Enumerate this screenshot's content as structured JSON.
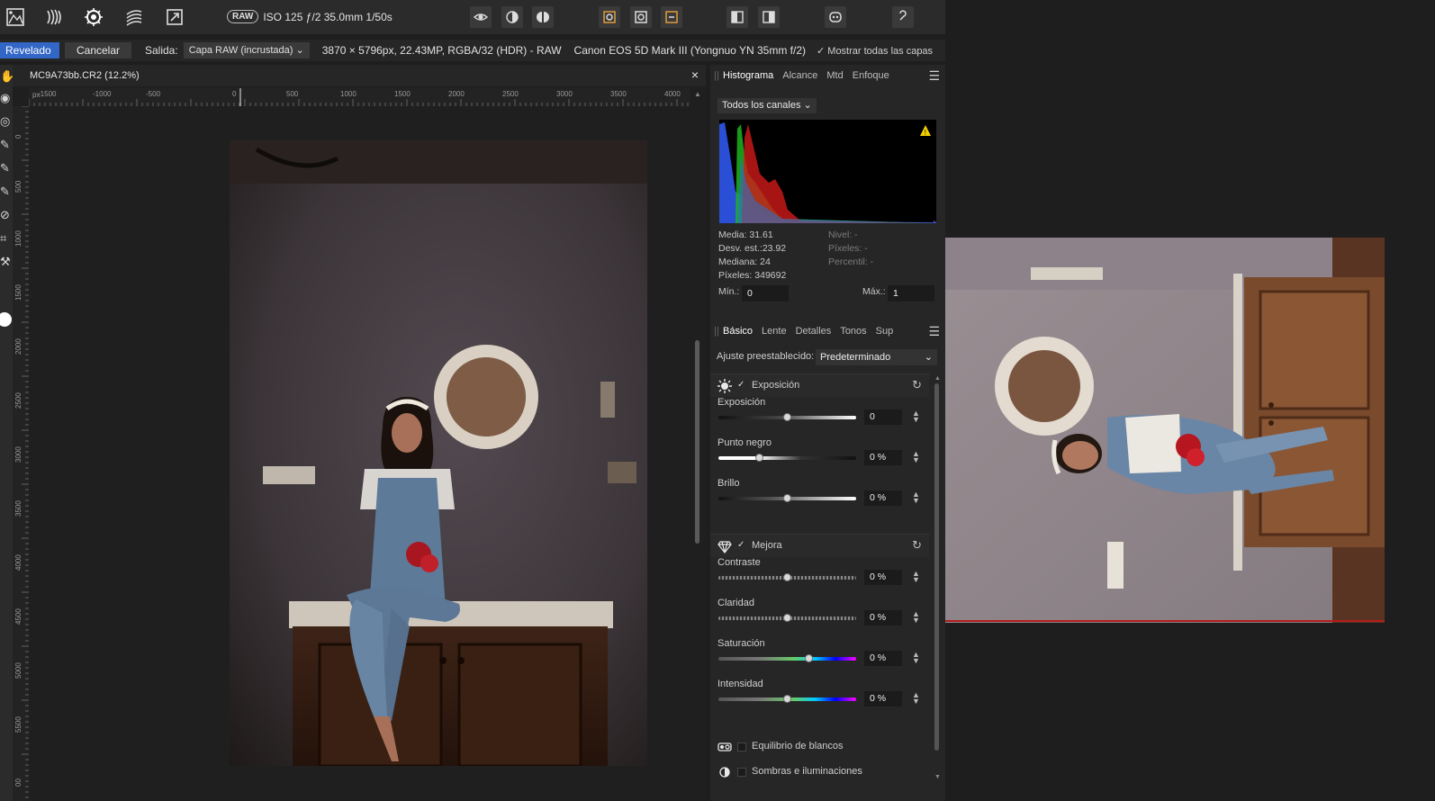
{
  "toolbar": {
    "raw_badge": "RAW",
    "exif": "ISO 125 ƒ/2 35.0mm 1/50s"
  },
  "context": {
    "develop_label": "Revelado",
    "cancel_label": "Cancelar",
    "output_label": "Salida:",
    "output_value": "Capa RAW (incrustada)",
    "image_info": "3870 × 5796px, 22.43MP, RGBA/32 (HDR) - RAW",
    "camera_info": "Canon EOS 5D Mark III (Yongnuo YN 35mm f/2)",
    "show_layers": "Mostrar todas las capas"
  },
  "document": {
    "title": "MC9A73bb.CR2 (12.2%)",
    "close": "×",
    "ruler_unit": "px",
    "h_ticks": [
      "-1500",
      "-1000",
      "-500",
      "0",
      "500",
      "1000",
      "1500",
      "2000",
      "2500",
      "3000",
      "3500",
      "4000"
    ],
    "v_ticks": [
      "0",
      "500",
      "1000",
      "1500",
      "2000",
      "2500",
      "3000",
      "3500",
      "4000",
      "4500",
      "5000",
      "5500",
      "00"
    ]
  },
  "histogram_panel": {
    "tabs": [
      "Histograma",
      "Alcance",
      "Mtd",
      "Enfoque"
    ],
    "channel": "Todos los canales",
    "stats_left": [
      "Media: 31.61",
      "Desv. est.:23.92",
      "Mediana: 24",
      "Píxeles: 349692"
    ],
    "stats_right": [
      "Nivel: -",
      "Píxeles: -",
      "Percentil: -"
    ],
    "min_label": "Mín.:",
    "min_value": "0",
    "max_label": "Máx.:",
    "max_value": "1"
  },
  "basic_panel": {
    "tabs": [
      "Básico",
      "Lente",
      "Detalles",
      "Tonos",
      "Sup"
    ],
    "preset_label": "Ajuste preestablecido:",
    "preset_value": "Predeterminado",
    "exposure_section": "Exposición",
    "enhance_section": "Mejora",
    "white_balance": "Equilibrio de blancos",
    "shadows_highlights": "Sombras e iluminaciones",
    "sliders": [
      {
        "label": "Exposición",
        "value": "0",
        "position": 0.5
      },
      {
        "label": "Punto negro",
        "value": "0 %",
        "position": 0.3
      },
      {
        "label": "Brillo",
        "value": "0 %",
        "position": 0.5
      },
      {
        "label": "Contraste",
        "value": "0 %",
        "position": 0.5
      },
      {
        "label": "Claridad",
        "value": "0 %",
        "position": 0.5
      },
      {
        "label": "Saturación",
        "value": "0 %",
        "position": 0.66
      },
      {
        "label": "Intensidad",
        "value": "0 %",
        "position": 0.5
      }
    ]
  },
  "colors": {
    "accent": "#3266c7",
    "panel_bg": "#262626",
    "toolbar_bg": "#2b2b2b"
  }
}
